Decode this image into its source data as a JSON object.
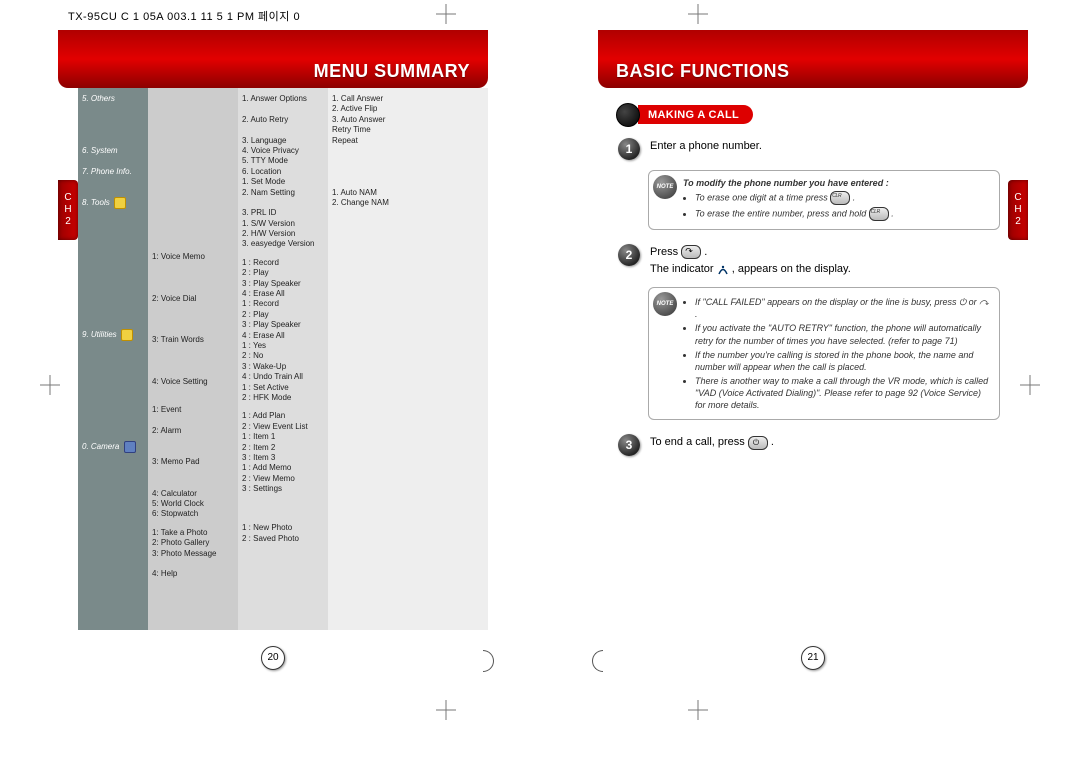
{
  "header_strip": "TX-95CU  C 1  05A   003.1   11 5  1 PM  페이지 0",
  "ch_label": "C\nH\n2",
  "left": {
    "title": "MENU SUMMARY",
    "pagenum": "20",
    "col1": [
      {
        "label": "",
        "items": [
          "5. Others",
          "",
          "",
          "",
          "",
          "",
          "6. System",
          "",
          "",
          "7. Phone Info."
        ]
      },
      {
        "label": "8. Tools",
        "icon": "yellow"
      },
      {
        "label": "9. Utilities",
        "icon": "yellow"
      },
      {
        "label": "0. Camera",
        "icon": "blue"
      }
    ],
    "col2_groups": [
      [
        "",
        "",
        "",
        "",
        "",
        "",
        "",
        "",
        "",
        ""
      ],
      [
        "1: Voice Memo",
        "",
        "",
        "",
        "2: Voice Dial",
        "",
        "",
        "",
        "3: Train Words",
        "",
        "",
        "",
        "4: Voice Setting",
        ""
      ],
      [
        "1: Event",
        "",
        "2: Alarm",
        "",
        "",
        "",
        "3: Memo Pad",
        "",
        "",
        "4: Calculator",
        "5: World Clock",
        "6: Stopwatch"
      ],
      [
        "1: Take a Photo",
        "2: Photo Gallery",
        "3: Photo Message",
        "",
        "4: Help"
      ]
    ],
    "col3_groups": [
      [
        "1. Answer Options",
        "",
        "2. Auto Retry",
        "",
        "3. Language",
        "4. Voice Privacy",
        "5. TTY Mode",
        "6. Location",
        "1. Set Mode",
        "2. Nam Setting",
        "",
        "3. PRL ID",
        "1. S/W Version",
        "2. H/W Version",
        "3. easyedge Version"
      ],
      [
        "1 : Record",
        "2 : Play",
        "3 : Play Speaker",
        "4 : Erase All",
        "1 : Record",
        "2 : Play",
        "3 : Play Speaker",
        "4 : Erase All",
        "1 : Yes",
        "2 : No",
        "3 : Wake-Up",
        "4 : Undo Train All",
        "1 : Set Active",
        "2 : HFK Mode"
      ],
      [
        "1 : Add Plan",
        "2 : View Event List",
        "1 : Item 1",
        "2 : Item 2",
        "3 : Item 3",
        "1 : Add Memo",
        "2 : View Memo",
        "3 : Settings"
      ],
      [
        "",
        "",
        "1 : New Photo",
        "2 : Saved Photo"
      ]
    ],
    "col4_groups": [
      [
        "1. Call Answer",
        "2. Active Flip",
        "3. Auto Answer",
        "Retry Time",
        "Repeat",
        "",
        "",
        "",
        "",
        "1. Auto NAM",
        "2. Change NAM"
      ]
    ]
  },
  "right": {
    "title": "BASIC FUNCTIONS",
    "pagenum": "21",
    "section_heading": "MAKING A CALL",
    "step1": "Enter a phone number.",
    "note1_title": "To modify the phone number you have entered :",
    "note1_items": [
      "To erase one digit at a time press ⌧ .",
      "To erase the entire number, press and hold ⌧ ."
    ],
    "step2_a": "Press",
    "step2_b": "The indicator",
    "step2_c": ", appears on the display.",
    "note2_items": [
      "If \"CALL FAILED\" appears on the display or the line is busy, press ⏻ or ↷ .",
      "If you activate the \"AUTO RETRY\" function, the phone will automatically retry for the number of times you have selected. (refer to page 71)",
      "If the number you're calling is stored in the phone book, the name and number will appear when the call is placed.",
      "There is another way to make a call through the VR mode, which is called \"VAD (Voice Activated Dialing)\". Please refer to page 92 (Voice Service) for more details."
    ],
    "step3": "To end a call, press"
  }
}
